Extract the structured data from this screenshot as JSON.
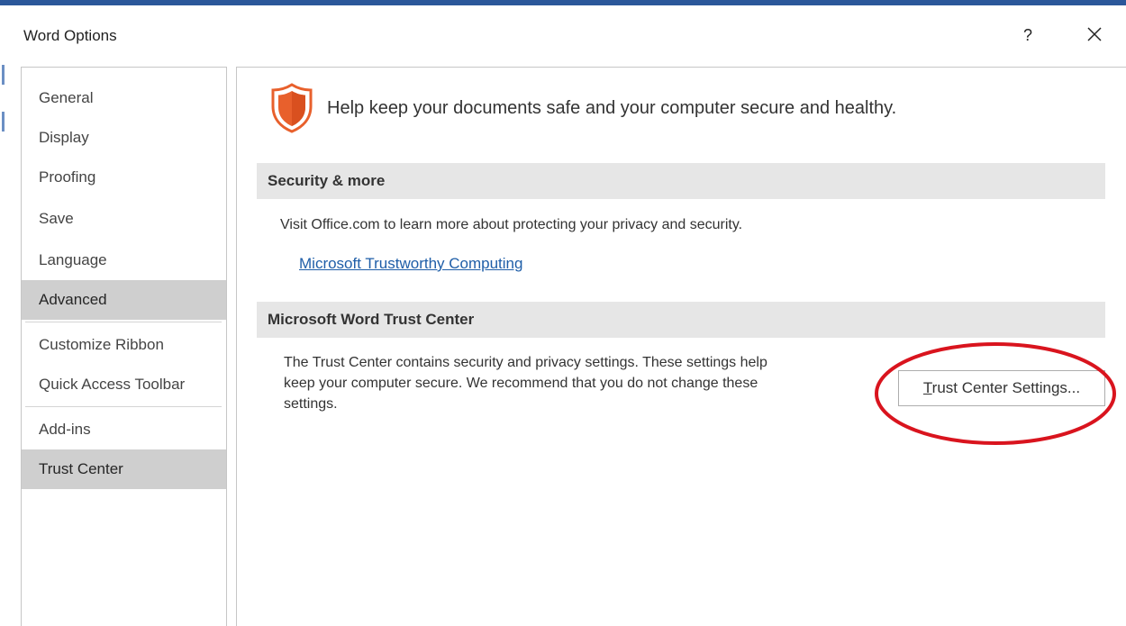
{
  "window": {
    "title": "Word Options",
    "help_label": "?",
    "close_icon": "close-icon"
  },
  "sidebar": {
    "items": [
      {
        "label": "General",
        "selected": false
      },
      {
        "label": "Display",
        "selected": false
      },
      {
        "label": "Proofing",
        "selected": false
      },
      {
        "label": "Save",
        "selected": false
      },
      {
        "label": "Language",
        "selected": false
      },
      {
        "label": "Advanced",
        "selected": true
      },
      {
        "label": "Customize Ribbon",
        "selected": false
      },
      {
        "label": "Quick Access Toolbar",
        "selected": false
      },
      {
        "label": "Add-ins",
        "selected": false
      },
      {
        "label": "Trust Center",
        "selected": true
      }
    ]
  },
  "main": {
    "headline": "Help keep your documents safe and your computer secure and healthy.",
    "headline_icon": "shield-icon",
    "security_section": {
      "title": "Security & more",
      "text": "Visit Office.com to learn more about protecting your privacy and security.",
      "link": "Microsoft Trustworthy Computing"
    },
    "trust_center_section": {
      "title": "Microsoft Word Trust Center",
      "text_lines": [
        "The Trust Center contains security and privacy settings. These settings help",
        "keep your computer secure. We recommend that you do not change these",
        "settings."
      ],
      "button_mnemonic": "T",
      "button_rest": "rust Center Settings..."
    }
  },
  "colors": {
    "accent": "#2b579a",
    "selected_nav": "#cfcfcf",
    "section_header_bg": "#e6e6e6",
    "link": "#1f5ea8",
    "shield_orange": "#e8602c",
    "highlight_red": "#d9141e"
  }
}
